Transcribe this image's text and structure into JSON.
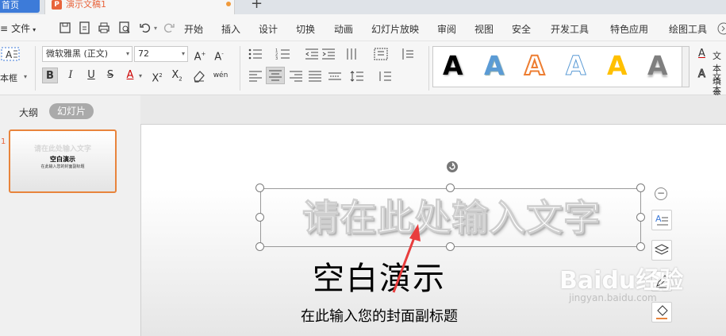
{
  "tabs": {
    "home_label": "首页",
    "doc_title": "演示文稿1",
    "new_tab": "+"
  },
  "menu": {
    "file": "文件",
    "items": [
      "开始",
      "插入",
      "设计",
      "切换",
      "动画",
      "幻灯片放映",
      "审阅",
      "视图",
      "安全",
      "开发工具",
      "特色应用",
      "绘图工具"
    ]
  },
  "ribbon": {
    "textbox_label": "本框",
    "font_name": "微软雅黑 (正文)",
    "font_size": "72",
    "text_fill_label": "文本填充",
    "text_outline_label": "文本轮廓",
    "art_letter": "A",
    "art_colors": [
      "#000000",
      "#5b9bd5",
      "#ed7d31",
      "#ffffff",
      "#ffc000",
      "#7f7f7f"
    ]
  },
  "left_panel": {
    "outline_tab": "大纲",
    "slides_tab": "幻灯片",
    "slide_number": "1",
    "thumb_title": "请在此处输入文字",
    "thumb_subtitle": "空白演示",
    "thumb_caption": "在此输入您的封面副标题"
  },
  "slide": {
    "title": "请在此处输入文字",
    "subtitle": "空白演示",
    "caption": "在此输入您的封面副标题"
  },
  "watermark": {
    "brand": "Baidu经验",
    "url": "jingyan.baidu.com"
  },
  "colors": {
    "accent_blue": "#3d7bd9",
    "accent_orange": "#e8643c",
    "arrow_red": "#e83d3d"
  }
}
